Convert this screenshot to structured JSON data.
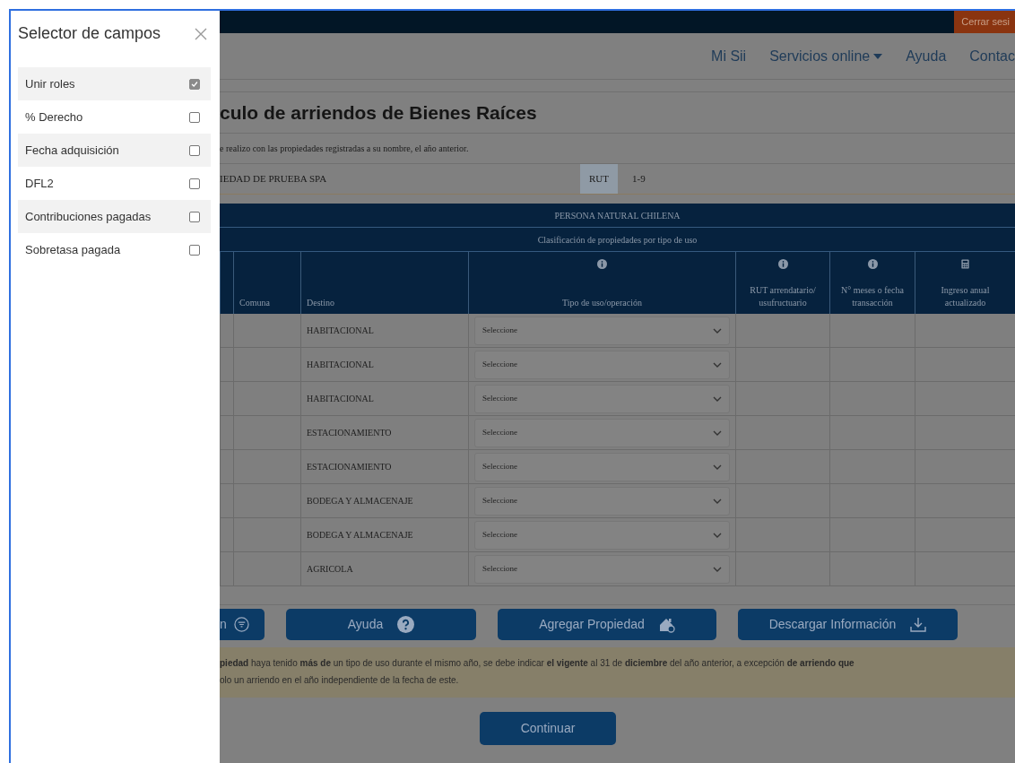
{
  "panel": {
    "title": "Selector de campos",
    "fields": [
      {
        "label": "Unir roles",
        "checked": true
      },
      {
        "label": "% Derecho",
        "checked": false
      },
      {
        "label": "Fecha adquisición",
        "checked": false
      },
      {
        "label": "DFL2",
        "checked": false
      },
      {
        "label": "Contribuciones pagadas",
        "checked": false
      },
      {
        "label": "Sobretasa pagada",
        "checked": false
      }
    ]
  },
  "top_bar": {
    "logout": "Cerrar sesi"
  },
  "nav": [
    {
      "label": "Mi Sii",
      "dropdown": false
    },
    {
      "label": "Servicios online",
      "dropdown": true
    },
    {
      "label": "Ayuda",
      "dropdown": false
    },
    {
      "label": "Contac",
      "dropdown": false
    }
  ],
  "page": {
    "title": "culo de arriendos de Bienes Raíces",
    "subtitle": "e realizo con las propiedades registradas a su nombre, el año anterior.",
    "owner": "IEDAD DE PRUEBA SPA",
    "rut_label": "RUT",
    "rut": "1-9"
  },
  "table": {
    "group": "PERSONA NATURAL CHILENA",
    "caption": "Clasificación de propiedades por tipo de uso",
    "columns": [
      {
        "label": "Comuna"
      },
      {
        "label": "Destino"
      },
      {
        "label": "Tipo de uso/operación"
      },
      {
        "label": "RUT arrendatario/ usufructuario"
      },
      {
        "label": "N° meses o fecha transacción"
      },
      {
        "label": "Ingreso anual actualizado"
      }
    ],
    "rows": [
      {
        "destino": "HABITACIONAL",
        "tipo": "Seleccione"
      },
      {
        "destino": "HABITACIONAL",
        "tipo": "Seleccione"
      },
      {
        "destino": "HABITACIONAL",
        "tipo": "Seleccione"
      },
      {
        "destino": "ESTACIONAMIENTO",
        "tipo": "Seleccione"
      },
      {
        "destino": "ESTACIONAMIENTO",
        "tipo": "Seleccione"
      },
      {
        "destino": "BODEGA Y ALMACENAJE",
        "tipo": "Seleccione"
      },
      {
        "destino": "BODEGA Y ALMACENAJE",
        "tipo": "Seleccione"
      },
      {
        "destino": "AGRICOLA",
        "tipo": "Seleccione"
      }
    ]
  },
  "actions": [
    {
      "label": "n"
    },
    {
      "label": "Ayuda"
    },
    {
      "label": "Agregar Propiedad"
    },
    {
      "label": "Descargar Información"
    }
  ],
  "note": [
    "**piedad** haya tenido **más de** un tipo de uso durante el mismo año, se debe indicar **el vigente** al 31 de **diciembre** del año anterior, a excepción **de arriendo que**",
    "olo un arriendo en el año independiente de la fecha de este."
  ],
  "continue": "Continuar"
}
